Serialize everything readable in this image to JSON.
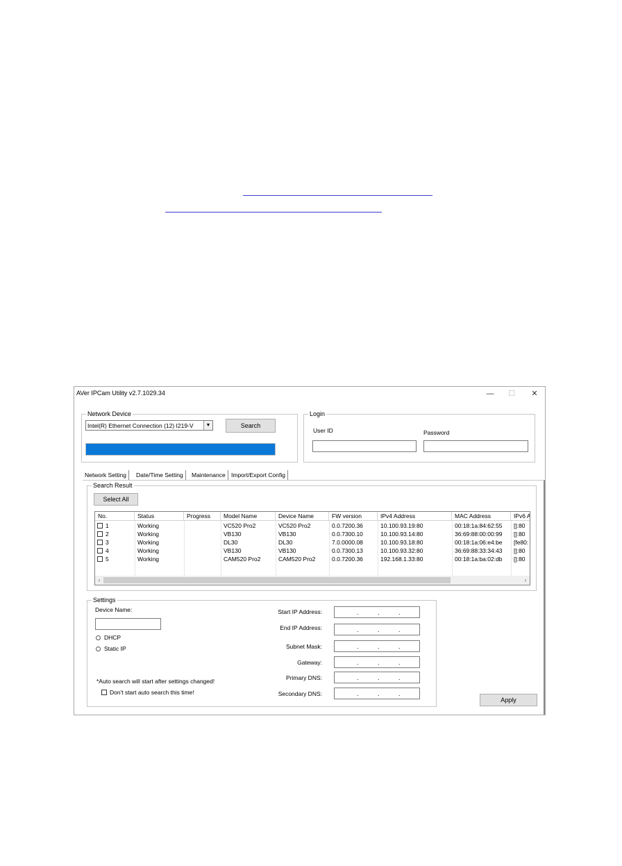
{
  "window": {
    "title": "AVer IPCam Utility v2.7.1029.34",
    "minimize_glyph": "—",
    "maximize_glyph": "☐",
    "close_glyph": "✕"
  },
  "network_device": {
    "group_label": "Network Device",
    "adapter_value": "Intel(R) Ethernet Connection (12) I219-V",
    "dropdown_icon": "chevron-down-icon",
    "search_button": "Search",
    "progress": 1.0,
    "progress_color": "#0a78d7"
  },
  "login": {
    "group_label": "Login",
    "user_id_label": "User ID",
    "password_label": "Password",
    "user_id_value": "",
    "password_value": ""
  },
  "tabs": [
    {
      "label": "Network Setting"
    },
    {
      "label": "Date/Time Setting"
    },
    {
      "label": "Maintenance"
    },
    {
      "label": "Import/Export Config"
    }
  ],
  "search_result": {
    "group_label": "Search Result",
    "select_all_button": "Select All",
    "columns": [
      "No.",
      "Status",
      "Progress",
      "Model Name",
      "Device Name",
      "FW version",
      "IPv4 Address",
      "MAC Address",
      "IPv6 A"
    ],
    "rows": [
      {
        "no": "1",
        "status": "Working",
        "progress": "",
        "model": "VC520 Pro2",
        "device": "VC520 Pro2",
        "fw": "0.0.7200.36",
        "ipv4": "10.100.93.19:80",
        "mac": "00:18:1a:84:62:55",
        "ipv6": "[]:80"
      },
      {
        "no": "2",
        "status": "Working",
        "progress": "",
        "model": "VB130",
        "device": "VB130",
        "fw": "0.0.7300.10",
        "ipv4": "10.100.93.14:80",
        "mac": "36:69:88:00:00:99",
        "ipv6": "[]:80"
      },
      {
        "no": "3",
        "status": "Working",
        "progress": "",
        "model": "DL30",
        "device": "DL30",
        "fw": "7.0.0000.08",
        "ipv4": "10.100.93.18:80",
        "mac": "00:18:1a:06:e4:be",
        "ipv6": "[fe80:"
      },
      {
        "no": "4",
        "status": "Working",
        "progress": "",
        "model": "VB130",
        "device": "VB130",
        "fw": "0.0.7300.13",
        "ipv4": "10.100.93.32:80",
        "mac": "36:69:88:33:34:43",
        "ipv6": "[]:80"
      },
      {
        "no": "5",
        "status": "Working",
        "progress": "",
        "model": "CAM520 Pro2",
        "device": "CAM520 Pro2",
        "fw": "0.0.7200.36",
        "ipv4": "192.168.1.33:80",
        "mac": "00:18:1a:ba:02:db",
        "ipv6": "[]:80"
      }
    ],
    "scroll_left": "‹",
    "scroll_right": "›"
  },
  "settings": {
    "group_label": "Settings",
    "device_name_label": "Device Name:",
    "device_name_value": "",
    "dhcp_label": "DHCP",
    "static_ip_label": "Static IP",
    "note": "*Auto search will start after settings changed!",
    "dont_search_label": "Don't start auto search this time!",
    "start_ip_label": "Start IP Address:",
    "end_ip_label": "End IP Address:",
    "subnet_label": "Subnet Mask:",
    "gateway_label": "Gateway:",
    "primary_dns_label": "Primary DNS:",
    "secondary_dns_label": "Secondary DNS:",
    "ip_separator": "."
  },
  "apply_button": "Apply"
}
